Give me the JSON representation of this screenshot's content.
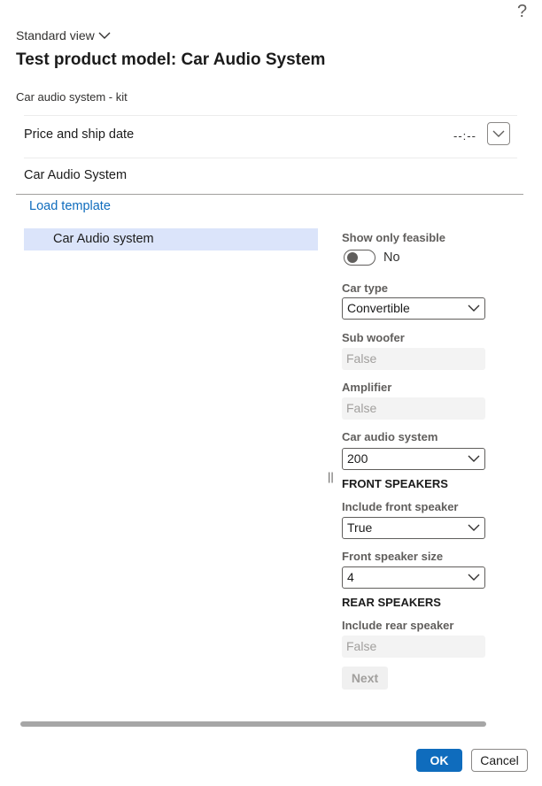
{
  "header": {
    "help_glyph": "?",
    "view_label": "Standard view",
    "title": "Test product model: Car Audio System",
    "subtitle": "Car audio system - kit"
  },
  "sections": {
    "price_ship": "Price and ship date",
    "price_ship_time": "--:--",
    "model_name": "Car Audio System"
  },
  "tree": {
    "load_template": "Load template",
    "items": [
      "Car Audio system"
    ]
  },
  "form": {
    "show_feasible_label": "Show only feasible",
    "show_feasible_value": "No",
    "car_type_label": "Car type",
    "car_type_value": "Convertible",
    "sub_woofer_label": "Sub woofer",
    "sub_woofer_value": "False",
    "amplifier_label": "Amplifier",
    "amplifier_value": "False",
    "car_audio_label": "Car audio system",
    "car_audio_value": "200",
    "front_speakers_heading": "FRONT SPEAKERS",
    "include_front_label": "Include front speaker",
    "include_front_value": "True",
    "front_size_label": "Front speaker size",
    "front_size_value": "4",
    "rear_speakers_heading": "REAR SPEAKERS",
    "include_rear_label": "Include rear speaker",
    "include_rear_value": "False",
    "next_label": "Next"
  },
  "footer": {
    "ok_label": "OK",
    "cancel_label": "Cancel"
  },
  "colors": {
    "accent": "#0f6cbd",
    "selected_row": "#dbe4fa",
    "disabled_field": "#f3f3f3"
  },
  "icons": {
    "view_dropdown": "chevron-down-icon",
    "expand": "chevron-down-icon",
    "select": "chevron-down-icon",
    "help": "question-mark-icon"
  }
}
